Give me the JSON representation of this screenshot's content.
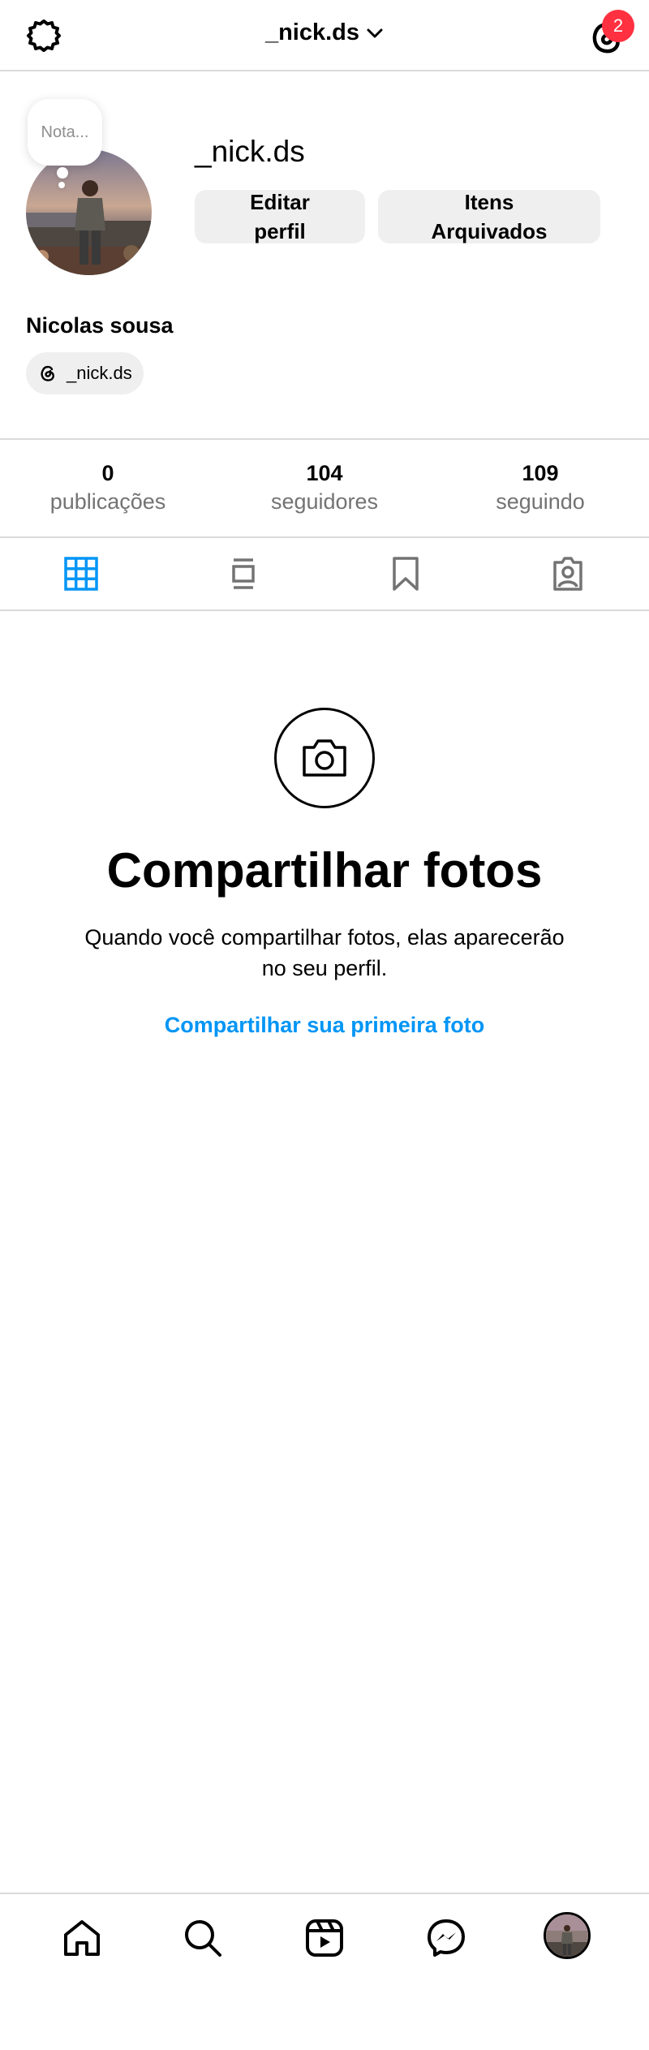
{
  "header": {
    "username": "_nick.ds",
    "notification_count": "2",
    "icons": {
      "settings": "gear-icon",
      "dropdown": "chevron-down-icon",
      "threads": "threads-icon"
    }
  },
  "profile": {
    "note": "Nota...",
    "username": "_nick.ds",
    "edit_button": "Editar perfil",
    "archived_button": "Itens Arquivados",
    "full_name": "Nicolas sousa",
    "threads_handle": "_nick.ds"
  },
  "stats": [
    {
      "count": "0",
      "label": "publicações"
    },
    {
      "count": "104",
      "label": "seguidores"
    },
    {
      "count": "109",
      "label": "seguindo"
    }
  ],
  "tabs": [
    {
      "name": "posts",
      "icon": "grid-icon",
      "active": true
    },
    {
      "name": "feed",
      "icon": "feed-icon",
      "active": false
    },
    {
      "name": "saved",
      "icon": "bookmark-icon",
      "active": false
    },
    {
      "name": "tagged",
      "icon": "tagged-icon",
      "active": false
    }
  ],
  "empty_state": {
    "icon": "camera-icon",
    "title": "Compartilhar fotos",
    "description": "Quando você compartilhar fotos, elas aparecerão no seu perfil.",
    "link": "Compartilhar sua primeira foto"
  },
  "bottom_nav": [
    {
      "name": "home",
      "icon": "home-icon"
    },
    {
      "name": "search",
      "icon": "search-icon"
    },
    {
      "name": "reels",
      "icon": "reels-icon"
    },
    {
      "name": "messenger",
      "icon": "messenger-icon"
    },
    {
      "name": "profile",
      "icon": "avatar"
    }
  ],
  "colors": {
    "accent": "#0095f6",
    "badge": "#ff3040",
    "button_bg": "#efefef",
    "divider": "#dbdbdb",
    "secondary_text": "#737373"
  }
}
